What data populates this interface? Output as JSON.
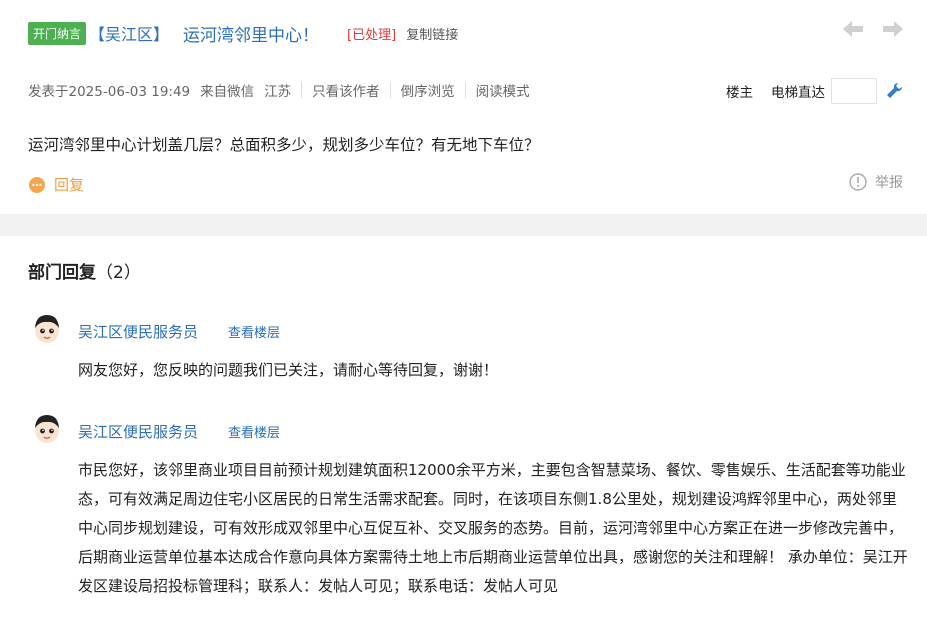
{
  "post": {
    "tag": "开门纳言",
    "district": "【吴江区】",
    "title": "运河湾邻里中心！",
    "status": "[已处理]",
    "copy_link": "复制链接",
    "published": "发表于2025-06-03 19:49",
    "source": "来自微信",
    "region": "江苏",
    "only_author": "只看该作者",
    "reverse": "倒序浏览",
    "read_mode": "阅读模式",
    "owner": "楼主",
    "elevator": "电梯直达",
    "question": "运河湾邻里中心计划盖几层？总面积多少，规划多少车位？有无地下车位？",
    "reply_label": "回复",
    "report_label": "举报"
  },
  "dept": {
    "title": "部门回复",
    "count": "（2）",
    "replies": [
      {
        "author": "吴江区便民服务员",
        "view_floor": "查看楼层",
        "body": "网友您好，您反映的问题我们已关注，请耐心等待回复，谢谢！"
      },
      {
        "author": "吴江区便民服务员",
        "view_floor": "查看楼层",
        "body": "市民您好，该邻里商业项目目前预计规划建筑面积12000余平方米，主要包含智慧菜场、餐饮、零售娱乐、生活配套等功能业态，可有效满足周边住宅小区居民的日常生活需求配套。同时，在该项目东侧1.8公里处，规划建设鸿辉邻里中心，两处邻里中心同步规划建设，可有效形成双邻里中心互促互补、交叉服务的态势。目前，运河湾邻里中心方案正在进一步修改完善中，后期商业运营单位基本达成合作意向具体方案需待土地上市后期商业运营单位出具，感谢您的关注和理解！ 承办单位：吴江开发区建设局招投标管理科；联系人：发帖人可见；联系电话：发帖人可见"
      }
    ]
  },
  "icons": {
    "prev": "arrow-left-icon",
    "next": "arrow-right-icon",
    "wrench": "wrench-icon",
    "reply": "chat-bubble-icon",
    "report": "info-circle-icon",
    "avatar": "cartoon-avatar-icon"
  },
  "colors": {
    "tag_bg": "#4caf50",
    "link": "#2b6fb8",
    "status": "#e23b3b",
    "reply": "#f0a040"
  }
}
